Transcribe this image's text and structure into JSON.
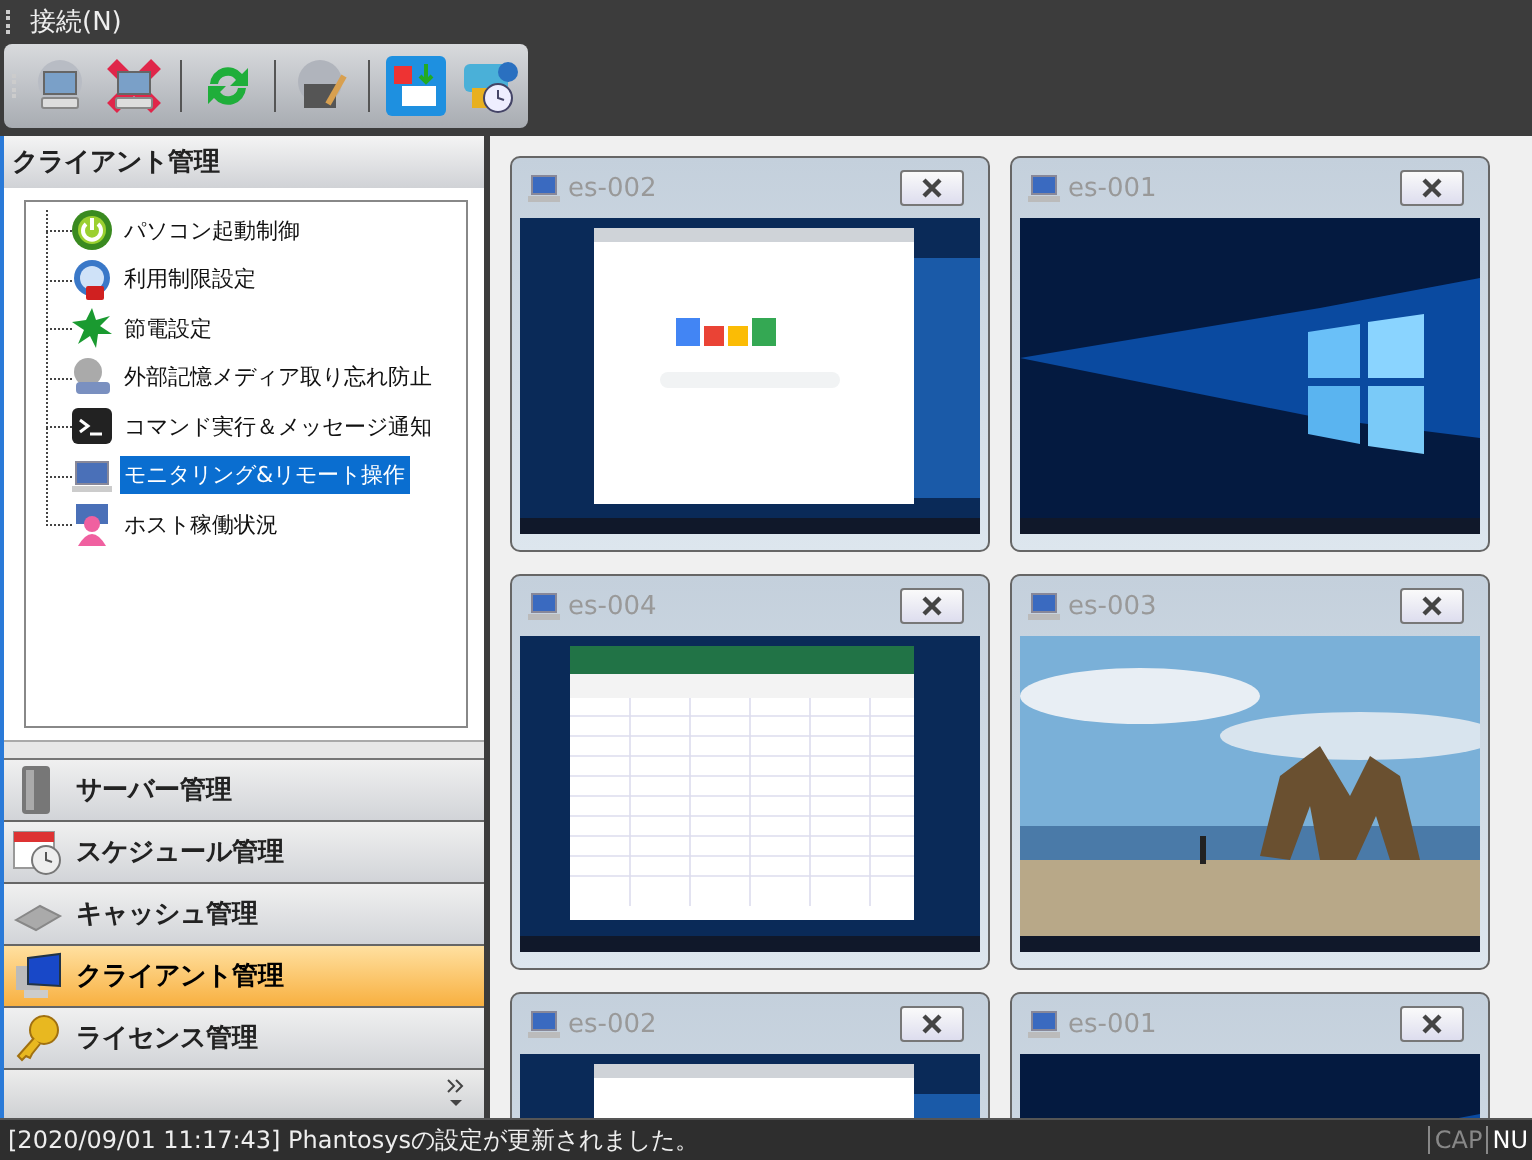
{
  "menu": [
    {
      "label": "接続(N)"
    }
  ],
  "panel": {
    "title": "クライアント管理"
  },
  "tree": [
    {
      "label": "パソコン起動制御",
      "selected": false
    },
    {
      "label": "利用制限設定",
      "selected": false
    },
    {
      "label": "節電設定",
      "selected": false
    },
    {
      "label": "外部記憶メディア取り忘れ防止",
      "selected": false
    },
    {
      "label": "コマンド実行＆メッセージ通知",
      "selected": false
    },
    {
      "label": "モニタリング&リモート操作",
      "selected": true
    },
    {
      "label": "ホスト稼働状況",
      "selected": false
    }
  ],
  "nav": [
    {
      "label": "サーバー管理",
      "selected": false
    },
    {
      "label": "スケジュール管理",
      "selected": false
    },
    {
      "label": "キャッシュ管理",
      "selected": false
    },
    {
      "label": "クライアント管理",
      "selected": true
    },
    {
      "label": "ライセンス管理",
      "selected": false
    }
  ],
  "clients": [
    {
      "name": "es-002"
    },
    {
      "name": "es-001"
    },
    {
      "name": "es-004"
    },
    {
      "name": "es-003"
    },
    {
      "name": "es-002"
    },
    {
      "name": "es-001"
    }
  ],
  "status": {
    "message": "[2020/09/01 11:17:43] Phantosysの設定が更新されました。",
    "indicators": [
      {
        "label": "CAP",
        "on": false
      },
      {
        "label": "NU",
        "on": true
      }
    ]
  }
}
